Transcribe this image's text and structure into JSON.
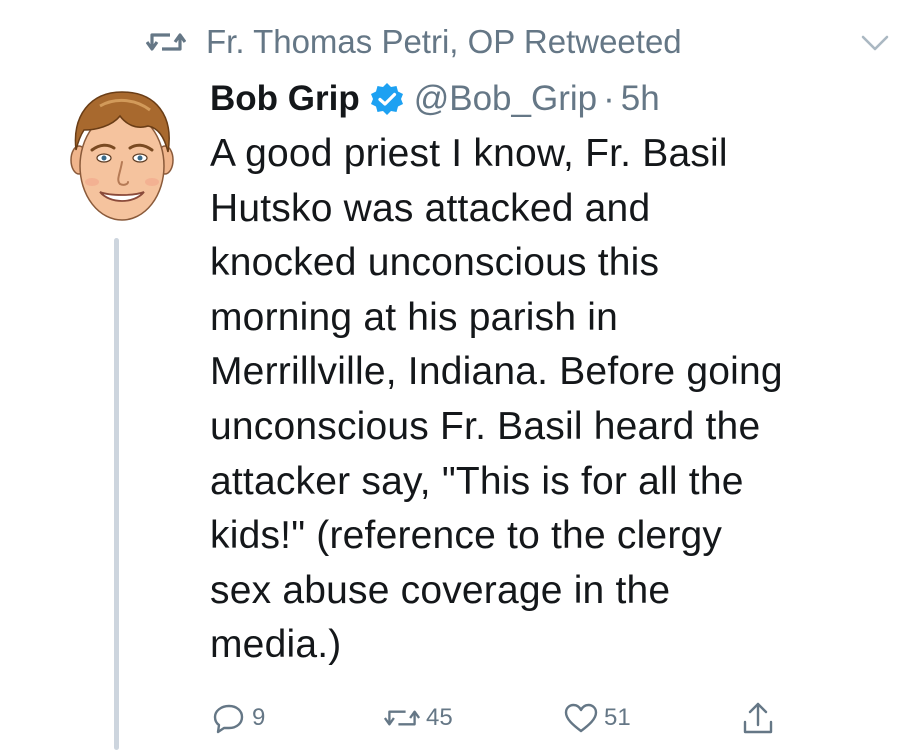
{
  "context": {
    "retweeter_text": "Fr. Thomas Petri, OP Retweeted",
    "retweet_icon": "retweet-icon",
    "menu_icon": "chevron-down-icon"
  },
  "tweet": {
    "display_name": "Bob Grip",
    "verified_icon": "verified-badge-icon",
    "handle": "@Bob_Grip",
    "separator": "·",
    "time": "5h",
    "text": "A good priest I know, Fr. Basil\nHutsko was attacked and\nknocked unconscious this\nmorning at his parish in\nMerrillville, Indiana. Before going\nunconscious Fr. Basil heard the\nattacker say, \"This is for all the\nkids!\"  (reference to the clergy\nsex abuse coverage in the\nmedia.)"
  },
  "actions": {
    "reply": {
      "icon": "reply-icon",
      "count": "9"
    },
    "retweet": {
      "icon": "retweet-icon",
      "count": "45"
    },
    "like": {
      "icon": "heart-icon",
      "count": "51"
    },
    "share": {
      "icon": "share-icon"
    }
  },
  "colors": {
    "text": "#14171a",
    "muted": "#657786",
    "verified": "#1da1f2",
    "thread_line": "#cdd5de"
  }
}
